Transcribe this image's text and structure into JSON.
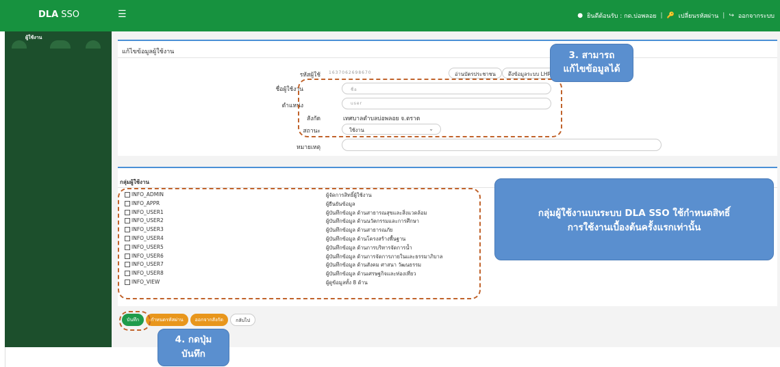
{
  "topbar": {
    "brand_bold": "DLA",
    "brand_rest": " SSO",
    "menu_icon": "☰",
    "welcome": "ยินดีต้อนรับ : กด.บ่อพลอย",
    "change_password": "เปลี่ยนรหัสผ่าน",
    "logout": "ออกจากระบบ",
    "separator": "|"
  },
  "sidebar": {
    "header_label": "ผู้ใช้งาน"
  },
  "edit_card": {
    "title": "แก้ไขข้อมูลผู้ใช้งาน",
    "user_id_label": "รหัสผู้ใช้",
    "user_id_value": "1637062698670",
    "read_id_card_button": "อ่านบัตรประชาชน",
    "fetch_lhr_button": "ดึงข้อมูลระบบ LHR",
    "name_label": "ชื่อผู้ใช้งาน",
    "name_value": "ชื่อ",
    "position_label": "ตำแหน่ง",
    "position_value": "user",
    "affiliation_label": "สังกัด",
    "affiliation_value": "เทศบาลตำบลบ่อพลอย จ.ตราด",
    "status_label": "สถานะ",
    "status_value": "ใช้งาน",
    "note_label": "หมายเหตุ",
    "note_value": ""
  },
  "groups_card": {
    "title": "กลุ่มผู้ใช้งาน",
    "groups": [
      {
        "code": "INFO_ADMIN",
        "desc": "ผู้จัดการสิทธิ์ผู้ใช้งาน"
      },
      {
        "code": "INFO_APPR",
        "desc": "ผู้ยืนยันข้อมูล"
      },
      {
        "code": "INFO_USER1",
        "desc": "ผู้บันทึกข้อมูล ด้านสาธารณสุขและสิ่งแวดล้อม"
      },
      {
        "code": "INFO_USER2",
        "desc": "ผู้บันทึกข้อมูล ด้านนวัตกรรมและการศึกษา"
      },
      {
        "code": "INFO_USER3",
        "desc": "ผู้บันทึกข้อมูล ด้านสาธารณภัย"
      },
      {
        "code": "INFO_USER4",
        "desc": "ผู้บันทึกข้อมูล ด้านโครงสร้างพื้นฐาน"
      },
      {
        "code": "INFO_USER5",
        "desc": "ผู้บันทึกข้อมูล ด้านการบริหารจัดการน้ำ"
      },
      {
        "code": "INFO_USER6",
        "desc": "ผู้บันทึกข้อมูล ด้านการจัดการภายในและธรรมาภิบาล"
      },
      {
        "code": "INFO_USER7",
        "desc": "ผู้บันทึกข้อมูล ด้านสังคม ศาสนา วัฒนธรรม"
      },
      {
        "code": "INFO_USER8",
        "desc": "ผู้บันทึกข้อมูล ด้านเศรษฐกิจและท่องเที่ยว"
      },
      {
        "code": "INFO_VIEW",
        "desc": "ผู้ดูข้อมูลทั้ง 8 ด้าน"
      }
    ]
  },
  "buttons": {
    "save": "บันทึก",
    "set_password": "กำหนดรหัสผ่าน",
    "remove_affiliation": "ออกจากสังกัด",
    "back": "กลับไป"
  },
  "annotations": {
    "step3_line1": "3. สามารถ",
    "step3_line2": "แก้ไขข้อมูลได้",
    "groups_note_line1": "กลุ่มผู้ใช้งานบนระบบ DLA SSO ใช้กำหนดสิทธิ์",
    "groups_note_line2": "การใช้งานเบื้องต้นครั้งแรกเท่านั้น",
    "step4_line1": "4. กดปุ่ม",
    "step4_line2": "บันทึก"
  },
  "colors": {
    "topbar": "#17923f",
    "sidebar": "#1c4f2c",
    "accent_border": "#4a8fd6",
    "save_button": "#1f9b4b",
    "orange_button": "#e8961c",
    "callout": "#5a8fcf",
    "dashed_outline": "#c0622a"
  }
}
